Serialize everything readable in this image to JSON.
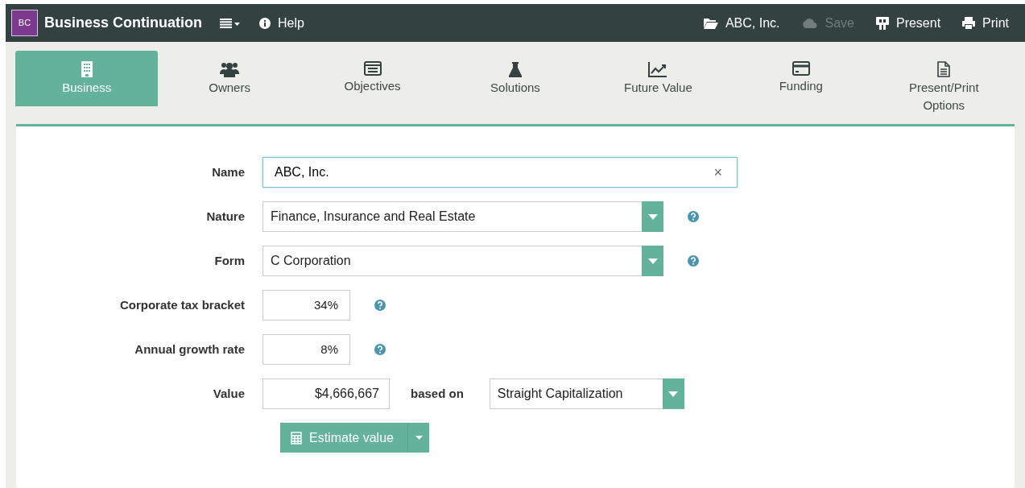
{
  "header": {
    "logo": "BC",
    "title": "Business Continuation",
    "help": "Help",
    "actions": [
      {
        "kind": "file",
        "label": "ABC, Inc.",
        "disabled": false
      },
      {
        "kind": "save",
        "label": "Save",
        "disabled": true
      },
      {
        "kind": "present",
        "label": "Present",
        "disabled": false
      },
      {
        "kind": "print",
        "label": "Print",
        "disabled": false
      }
    ]
  },
  "tabs": [
    {
      "kind": "building",
      "label": "Business",
      "selected": true
    },
    {
      "kind": "users",
      "label": "Owners",
      "selected": false
    },
    {
      "kind": "list",
      "label": "Objectives",
      "selected": false
    },
    {
      "kind": "flask",
      "label": "Solutions",
      "selected": false
    },
    {
      "kind": "chart",
      "label": "Future Value",
      "selected": false
    },
    {
      "kind": "card",
      "label": "Funding",
      "selected": false
    },
    {
      "kind": "doc",
      "label": "Present/Print Options",
      "selected": false
    }
  ],
  "form": [
    {
      "kind": "text",
      "label": "Name",
      "value": "ABC, Inc.",
      "focused": true,
      "clear": "×"
    },
    {
      "kind": "select",
      "label": "Nature",
      "value": "Finance, Insurance and Real Estate",
      "help": true
    },
    {
      "kind": "select",
      "label": "Form",
      "value": "C Corporation",
      "help": true
    },
    {
      "kind": "number",
      "label": "Corporate tax bracket",
      "value": "34%",
      "help": true
    },
    {
      "kind": "number",
      "label": "Annual growth rate",
      "value": "8%",
      "help": true
    },
    {
      "kind": "value",
      "label": "Value",
      "value": "$4,666,667",
      "based_on_label": "based on",
      "based_on": "Straight Capitalization"
    }
  ],
  "estimate_button": "Estimate value"
}
